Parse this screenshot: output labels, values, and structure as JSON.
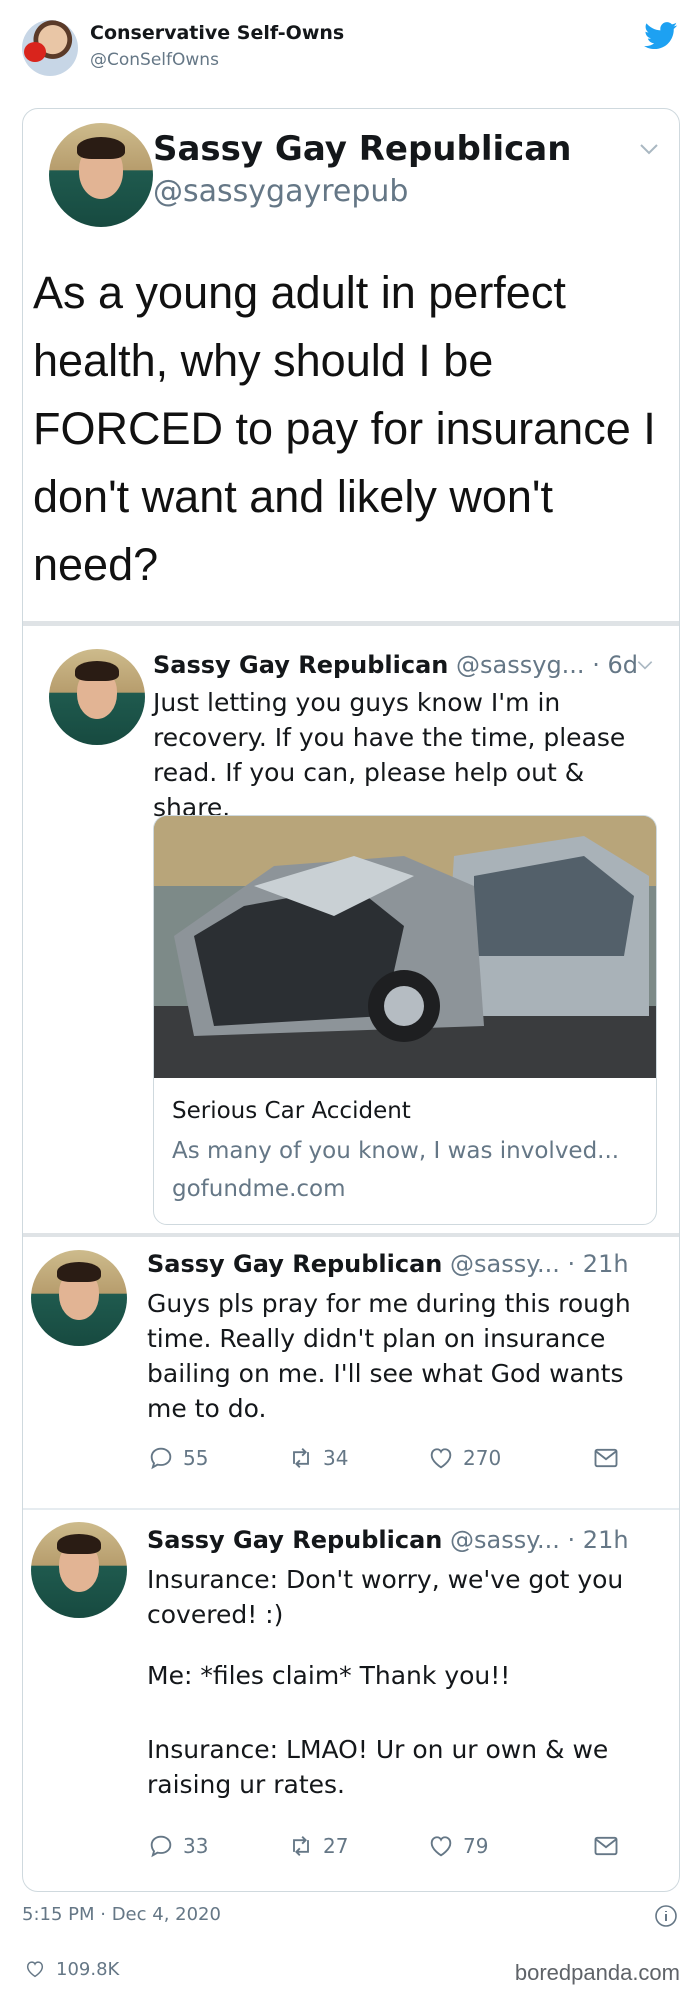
{
  "account": {
    "name": "Conservative Self-Owns",
    "handle": "@ConSelfOwns"
  },
  "quoted_tweet": {
    "name": "Sassy Gay Republican",
    "handle": "@sassygayrepub",
    "text": "As a young adult in perfect health, why should I be FORCED to pay for insurance I don't want and likely won't need?"
  },
  "reply_1": {
    "name": "Sassy Gay Republican",
    "handle": "@sassyg...",
    "time": "· 6d",
    "text": "Just letting you guys know I'm in recovery. If you have the time, please read. If you can, please help out & share.",
    "link_card": {
      "title": "Serious Car Accident",
      "description": "As many of you know, I was involved...",
      "domain": "gofundme.com"
    }
  },
  "reply_2": {
    "name": "Sassy Gay Republican",
    "handle": "@sassy...",
    "time": "· 21h",
    "text": "Guys pls pray for me during this rough time. Really didn't plan on insurance bailing on me. I'll see what God wants me to do.",
    "replies": "55",
    "retweets": "34",
    "likes": "270"
  },
  "reply_3": {
    "name": "Sassy Gay Republican",
    "handle": "@sassy...",
    "time": "· 21h",
    "text_lines": [
      "Insurance: Don't worry, we've got you covered! :)",
      "Me: *files claim* Thank you!!",
      "Insurance: LMAO! Ur on ur own & we raising ur rates."
    ],
    "replies": "33",
    "retweets": "27",
    "likes": "79"
  },
  "footer": {
    "timestamp": "5:15 PM · Dec 4, 2020",
    "likes": "109.8K",
    "watermark": "boredpanda.com"
  },
  "colors": {
    "twitter_blue": "#1da1f2",
    "muted_text": "#657786",
    "border": "#cfd9de"
  },
  "icons": [
    "twitter-bird-icon",
    "chevron-down-icon",
    "reply-icon",
    "retweet-icon",
    "heart-icon",
    "share-mail-icon",
    "info-icon"
  ]
}
